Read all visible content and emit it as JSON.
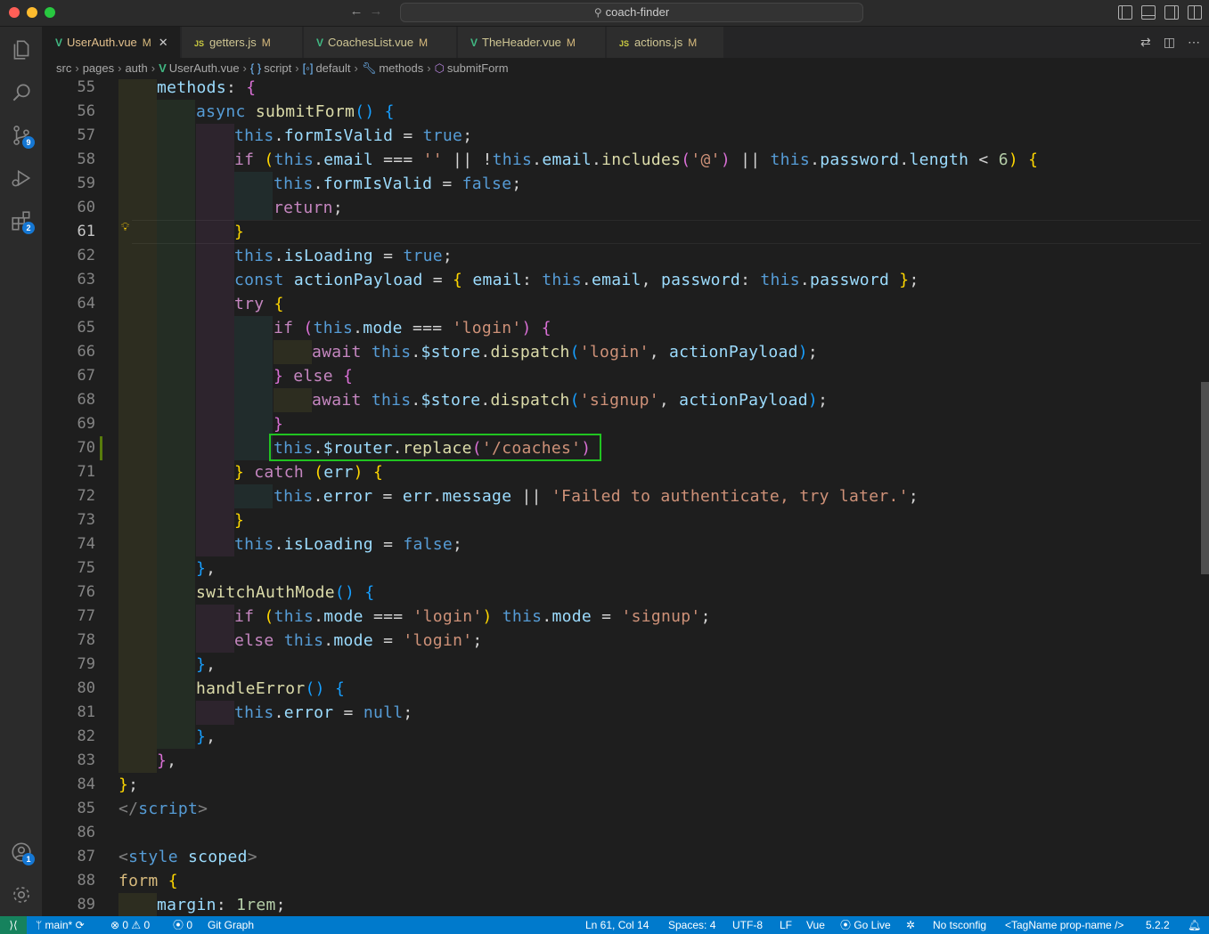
{
  "window": {
    "search_text": "coach-finder"
  },
  "activity_bar": {
    "scm_badge": "9",
    "extensions_badge": "2",
    "accounts_badge": "1"
  },
  "tabs": [
    {
      "label": "UserAuth.vue",
      "status": "M",
      "type": "vue",
      "active": true
    },
    {
      "label": "getters.js",
      "status": "M",
      "type": "js",
      "type_label": "JS"
    },
    {
      "label": "CoachesList.vue",
      "status": "M",
      "type": "vue"
    },
    {
      "label": "TheHeader.vue",
      "status": "M",
      "type": "vue"
    },
    {
      "label": "actions.js",
      "status": "M",
      "type": "js",
      "type_label": "JS"
    }
  ],
  "breadcrumb": {
    "items": [
      "src",
      "pages",
      "auth",
      "UserAuth.vue",
      "script",
      "default",
      "methods",
      "submitForm"
    ],
    "script_symbol": "{ }"
  },
  "editor": {
    "line_numbers": [
      "55",
      "56",
      "57",
      "58",
      "59",
      "60",
      "61",
      "62",
      "63",
      "64",
      "65",
      "66",
      "67",
      "68",
      "69",
      "70",
      "71",
      "72",
      "73",
      "74",
      "75",
      "76",
      "77",
      "78",
      "79",
      "80",
      "81",
      "82",
      "83",
      "84",
      "85",
      "86",
      "87",
      "88",
      "89"
    ],
    "current_line": "61"
  },
  "statusbar": {
    "branch": "main*",
    "errors": "0",
    "warnings": "0",
    "ports": "0",
    "git_graph": "Git Graph",
    "cursor": "Ln 61, Col 14",
    "spaces": "Spaces: 4",
    "encoding": "UTF-8",
    "eol": "LF",
    "language": "Vue",
    "go_live": "Go Live",
    "tsconfig": "No tsconfig",
    "tagname": "<TagName prop-name />",
    "version": "5.2.2"
  },
  "colors": {
    "statusbar_bg": "#007acc",
    "highlight_box": "#21c421",
    "tab_modified": "#e2c08d"
  }
}
